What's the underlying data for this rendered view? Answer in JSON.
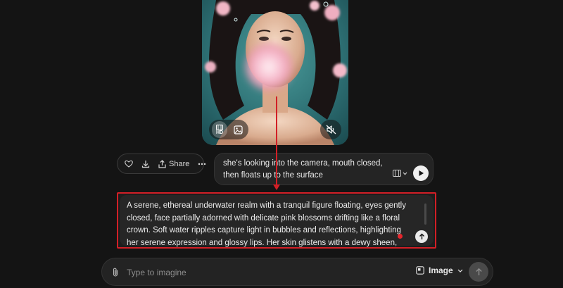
{
  "video": {
    "alt_icons": [
      "film-hd-icon",
      "image-icon",
      "mute-icon"
    ],
    "hd_label": "HD"
  },
  "actions": {
    "like_icon": "heart-icon",
    "download_icon": "download-icon",
    "share_label": "Share",
    "more_icon": "more-icon"
  },
  "prompt": {
    "lines": [
      "she's looking into the camera, mouth closed,",
      "then floats up to the surface"
    ]
  },
  "description": {
    "lines": [
      "A serene, ethereal underwater realm with a tranquil figure floating, eyes gently",
      "closed, face partially adorned with delicate pink blossoms drifting like a floral",
      "crown. Soft water ripples capture light in bubbles and reflections, highlighting",
      "her serene expression and glossy lips. Her skin glistens with a dewy sheen,"
    ]
  },
  "composer": {
    "placeholder": "Type to imagine",
    "mode_label": "Image"
  },
  "colors": {
    "background": "#141414",
    "annotation": "#d21f26"
  }
}
